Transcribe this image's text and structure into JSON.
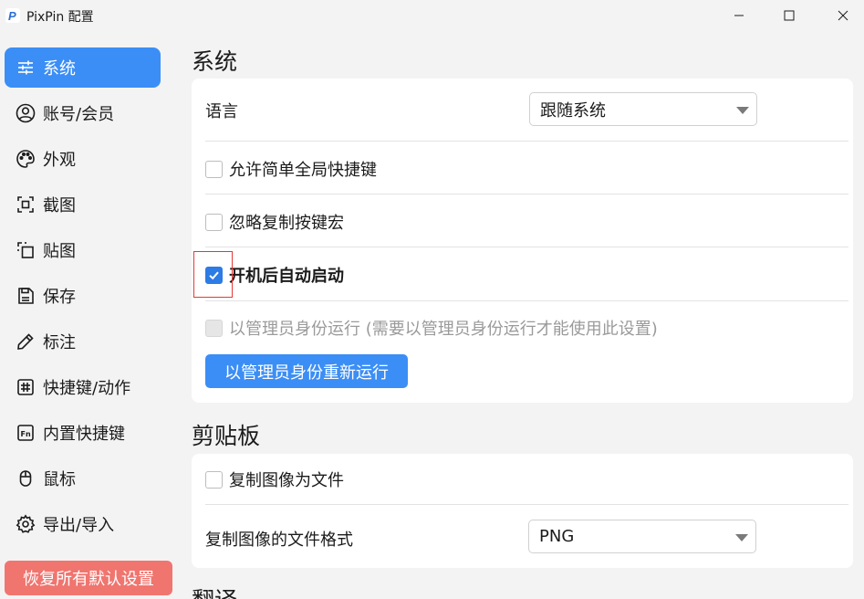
{
  "window": {
    "title": "PixPin 配置",
    "app_icon_letter": "P"
  },
  "sidebar": {
    "items": [
      {
        "label": "系统",
        "icon": "sliders-icon",
        "active": true
      },
      {
        "label": "账号/会员",
        "icon": "user-icon",
        "active": false
      },
      {
        "label": "外观",
        "icon": "palette-icon",
        "active": false
      },
      {
        "label": "截图",
        "icon": "screenshot-icon",
        "active": false
      },
      {
        "label": "贴图",
        "icon": "pin-image-icon",
        "active": false
      },
      {
        "label": "保存",
        "icon": "save-icon",
        "active": false
      },
      {
        "label": "标注",
        "icon": "pencil-icon",
        "active": false
      },
      {
        "label": "快捷键/动作",
        "icon": "hash-icon",
        "active": false
      },
      {
        "label": "内置快捷键",
        "icon": "fn-key-icon",
        "active": false
      },
      {
        "label": "鼠标",
        "icon": "mouse-icon",
        "active": false
      },
      {
        "label": "导出/导入",
        "icon": "gear-icon",
        "active": false
      }
    ],
    "reset_label": "恢复所有默认设置"
  },
  "main": {
    "system": {
      "title": "系统",
      "language_label": "语言",
      "language_value": "跟随系统",
      "options": [
        {
          "label": "允许简单全局快捷键",
          "checked": false,
          "disabled": false
        },
        {
          "label": "忽略复制按键宏",
          "checked": false,
          "disabled": false
        },
        {
          "label": "开机后自动启动",
          "checked": true,
          "disabled": false
        },
        {
          "label": "以管理员身份运行 (需要以管理员身份运行才能使用此设置)",
          "checked": false,
          "disabled": true
        }
      ],
      "restart_admin_label": "以管理员身份重新运行"
    },
    "clipboard": {
      "title": "剪贴板",
      "copy_as_file_label": "复制图像为文件",
      "copy_as_file_checked": false,
      "format_label": "复制图像的文件格式",
      "format_value": "PNG"
    },
    "translate": {
      "title": "翻译"
    }
  },
  "colors": {
    "accent": "#3b8ef5",
    "checkbox_checked": "#2d7be5",
    "danger_button": "#f0756f",
    "highlight": "#e53935"
  }
}
